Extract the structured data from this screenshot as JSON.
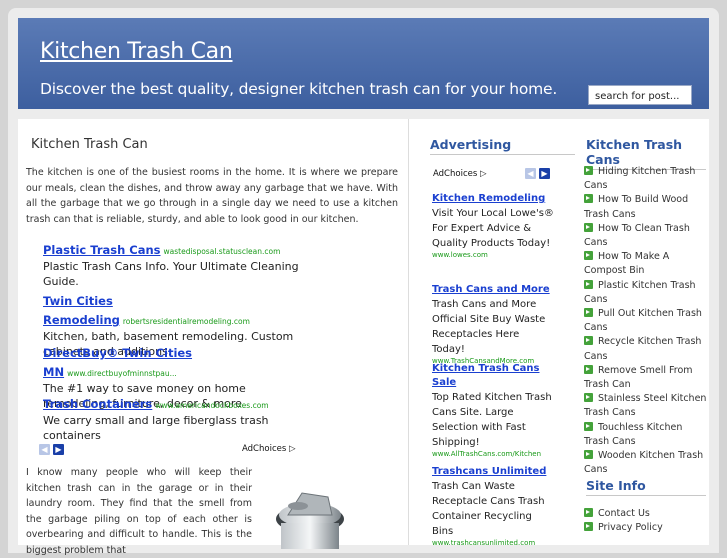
{
  "header": {
    "title": "Kitchen Trash Can",
    "tagline": "Discover the best quality, designer kitchen trash can for your home.",
    "search_placeholder": "search for post..."
  },
  "main": {
    "post_title": "Kitchen Trash Can",
    "intro": "The kitchen is one of the busiest rooms in the home. It is where we prepare our meals, clean the dishes, and throw away any garbage that we have. With all the garbage that we go through in a single day we need to use a kitchen trash can that is reliable, sturdy, and able to look good in our kitchen.",
    "ads": [
      {
        "title": "Plastic Trash Cans",
        "url": "wastedisposal.statusclean.com",
        "desc": "Plastic Trash Cans Info. Your Ultimate Cleaning Guide."
      },
      {
        "title": "Twin Cities Remodeling",
        "url": "robertsresidentialremodeling.com",
        "desc": "Kitchen, bath, basement remodeling. Custom cabinets and additions."
      },
      {
        "title": "DirectBuy® Twin Cities MN",
        "url": "www.directbuyofminnstpau...",
        "desc": "The #1 way to save money on home remodeling, furniture, decor & more"
      },
      {
        "title": "Trash Containers",
        "url": "www.americandockboxes.com",
        "desc": "We carry small and large fiberglass trash containers"
      }
    ],
    "adchoices": "AdChoices",
    "para2": "I know many people who will keep their kitchen trash can in the garage or in their laundry room. They find that the smell from the garbage piling on top of each other is overbearing and difficult to handle. This is the biggest problem that"
  },
  "advertising": {
    "heading": "Advertising",
    "adchoices": "AdChoices",
    "ads": [
      {
        "title": "Kitchen Remodeling",
        "desc": "Visit Your Local Lowe's® For Expert Advice & Quality Products Today!",
        "url": "www.lowes.com"
      },
      {
        "title": "Trash Cans and More",
        "desc": "Trash Cans and More Official Site Buy Waste Receptacles Here Today!",
        "url": "www.TrashCansandMore.com"
      },
      {
        "title": "Kitchen Trash Cans Sale",
        "desc": "Top Rated Kitchen Trash Cans Site. Large Selection with Fast Shipping!",
        "url": "www.AllTrashCans.com/Kitchen"
      },
      {
        "title": "Trashcans Unlimited",
        "desc": "Trash Can Waste Receptacle Cans Trash Container Recycling Bins",
        "url": "www.trashcansunlimited.com"
      }
    ]
  },
  "sidebar": {
    "heading": "Kitchen Trash Cans",
    "links": [
      "Hiding Kitchen Trash Cans",
      "How To Build Wood Trash Cans",
      "How To Clean Trash Cans",
      "How To Make A Compost Bin",
      "Plastic Kitchen Trash Cans",
      "Pull Out Kitchen Trash Cans",
      "Recycle Kitchen Trash Cans",
      "Remove Smell From Trash Can",
      "Stainless Steel Kitchen Trash Cans",
      "Touchless Kitchen Trash Cans",
      "Wooden Kitchen Trash Cans"
    ],
    "info_heading": "Site Info",
    "info_links": [
      "Contact Us",
      "Privacy Policy"
    ]
  },
  "colors": {
    "header_bg": "#4a6cad",
    "link_blue": "#1a3fd0",
    "heading_blue": "#2f57a0",
    "url_green": "#1a9a1a",
    "bullet_green": "#44a23a"
  }
}
